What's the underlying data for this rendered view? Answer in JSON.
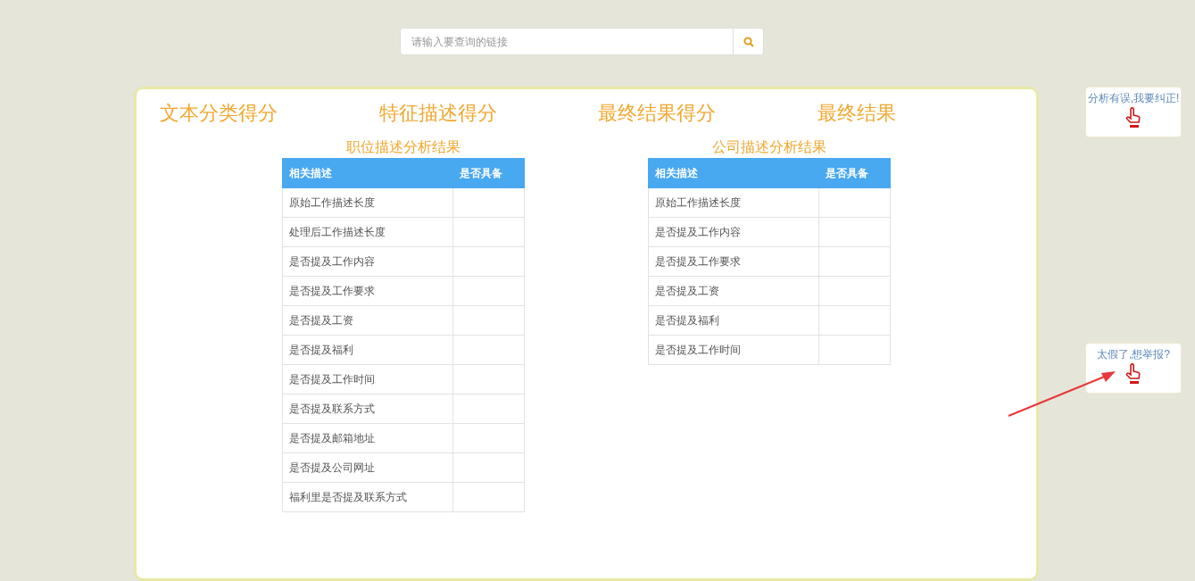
{
  "search": {
    "placeholder": "请输入要查询的链接"
  },
  "scores": [
    "文本分类得分",
    "特征描述得分",
    "最终结果得分",
    "最终结果"
  ],
  "tables": [
    {
      "title": "职位描述分析结果",
      "columns": [
        "相关描述",
        "是否具备"
      ],
      "rows": [
        [
          "原始工作描述长度",
          ""
        ],
        [
          "处理后工作描述长度",
          ""
        ],
        [
          "是否提及工作内容",
          ""
        ],
        [
          "是否提及工作要求",
          ""
        ],
        [
          "是否提及工资",
          ""
        ],
        [
          "是否提及福利",
          ""
        ],
        [
          "是否提及工作时间",
          ""
        ],
        [
          "是否提及联系方式",
          ""
        ],
        [
          "是否提及邮箱地址",
          ""
        ],
        [
          "是否提及公司网址",
          ""
        ],
        [
          "福利里是否提及联系方式",
          ""
        ]
      ]
    },
    {
      "title": "公司描述分析结果",
      "columns": [
        "相关描述",
        "是否具备"
      ],
      "rows": [
        [
          "原始工作描述长度",
          ""
        ],
        [
          "是否提及工作内容",
          ""
        ],
        [
          "是否提及工作要求",
          ""
        ],
        [
          "是否提及工资",
          ""
        ],
        [
          "是否提及福利",
          ""
        ],
        [
          "是否提及工作时间",
          ""
        ]
      ]
    }
  ],
  "side_buttons": [
    "分析有误,我要纠正!",
    "太假了,想举报?"
  ]
}
